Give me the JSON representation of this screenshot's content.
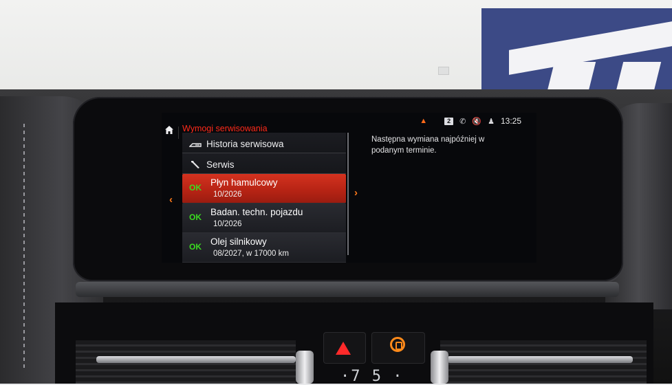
{
  "screen": {
    "title": "Wymogi serwisowania",
    "status": {
      "badge": "2",
      "time": "13:25",
      "icons": [
        "chevron-up-icon",
        "phone-signal-icon",
        "mute-icon",
        "user-icon"
      ]
    },
    "menu": {
      "links": [
        {
          "label": "Historia serwisowa",
          "icon": "service-history-icon"
        },
        {
          "label": "Serwis",
          "icon": "wrench-icon"
        }
      ],
      "items": [
        {
          "status": "OK",
          "name": "Płyn hamulcowy",
          "due": "10/2026",
          "selected": true
        },
        {
          "status": "OK",
          "name": "Badan. techn. pojazdu",
          "due": "10/2026",
          "selected": false
        },
        {
          "status": "OK",
          "name": "Olej silnikowy",
          "due": "08/2027, w 17000 km",
          "selected": false
        }
      ]
    },
    "detail_text": "Następna wymiana najpóźniej w podanym terminie."
  },
  "console": {
    "climate_readout": "·7 5 ·"
  },
  "colors": {
    "accent_red": "#ff2a1a",
    "accent_orange": "#ff7a1a",
    "ok_green": "#3bdc20",
    "selected_row": "#c22a18"
  }
}
